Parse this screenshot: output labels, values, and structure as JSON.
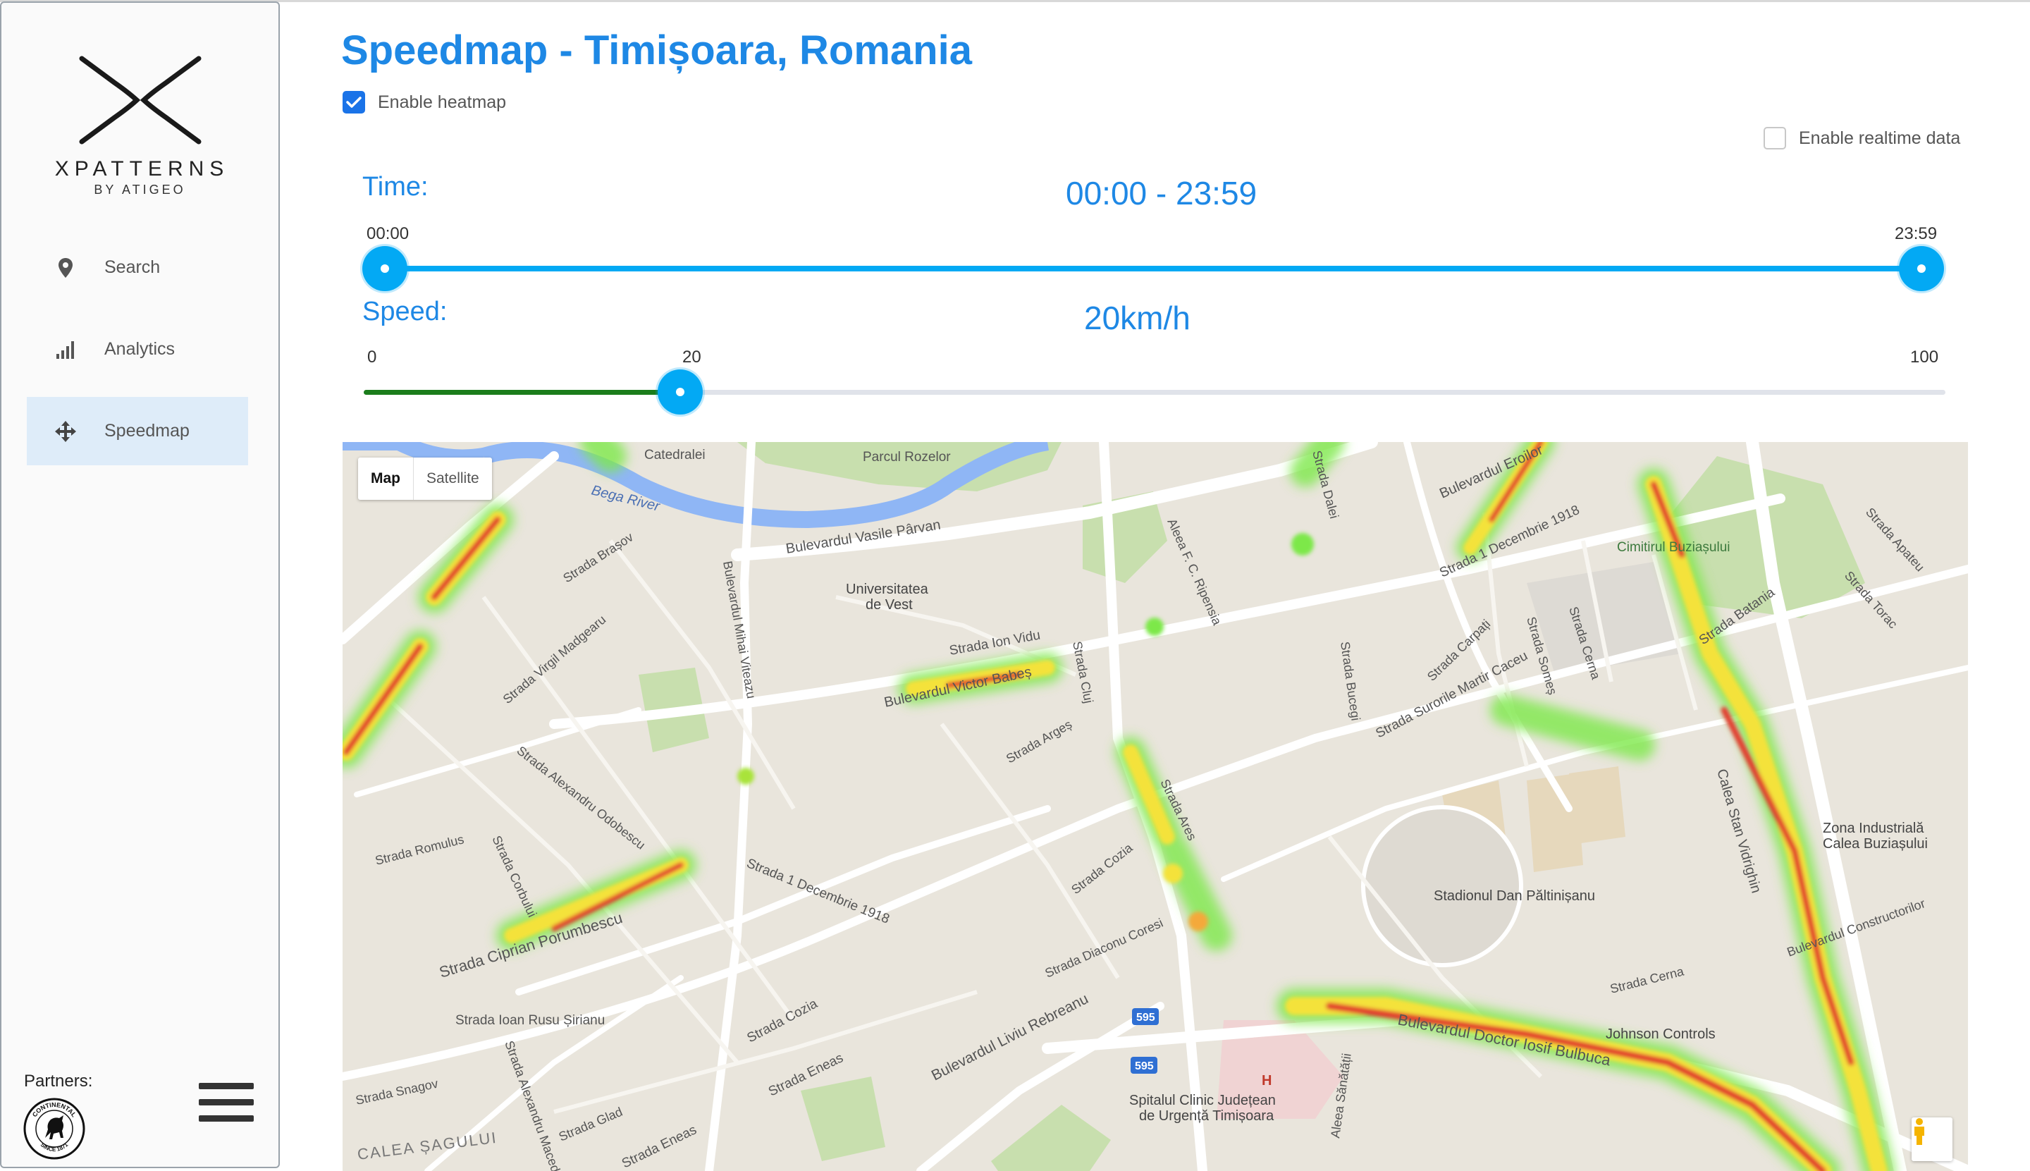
{
  "brand": {
    "name": "XPATTERNS",
    "tagline": "BY ATIGEO"
  },
  "sidebar": {
    "items": [
      {
        "label": "Search",
        "icon": "map-pin-icon",
        "active": false
      },
      {
        "label": "Analytics",
        "icon": "signal-bars-icon",
        "active": false
      },
      {
        "label": "Speedmap",
        "icon": "move-arrows-icon",
        "active": true
      }
    ],
    "partners_label": "Partners:",
    "partner_logo": {
      "name": "continental-logo",
      "text_top": "CONTINENTAL",
      "text_bottom": "SINCE 1871"
    },
    "menu_icon": "hamburger-icon"
  },
  "header": {
    "title": "Speedmap - Timișoara, Romania",
    "enable_heatmap": {
      "label": "Enable heatmap",
      "checked": true
    },
    "enable_realtime": {
      "label": "Enable realtime data",
      "checked": false
    }
  },
  "time_slider": {
    "label": "Time:",
    "value_text": "00:00 - 23:59",
    "min_label": "00:00",
    "max_label": "23:59",
    "range": [
      0,
      1439
    ],
    "low": 0,
    "high": 1439
  },
  "speed_slider": {
    "label": "Speed:",
    "value_text": "20km/h",
    "min_label": "0",
    "mid_label": "20",
    "max_label": "100",
    "range": [
      0,
      100
    ],
    "value": 20
  },
  "map": {
    "type_control": {
      "map": "Map",
      "satellite": "Satellite",
      "selected": "Map"
    },
    "labels": {
      "bega": "Bega River",
      "catedralei": "Catedralei",
      "parcul_rozelor": "Parcul Rozelor",
      "vasile_parvan": "Bulevardul Vasile Pârvan",
      "universitatea": "Universitatea",
      "de_vest": "de Vest",
      "ion_vidu": "Strada Ion Vidu",
      "victor_babes": "Bulevardul Victor Babeș",
      "mihai_viteazu": "Bulevardul Mihai Viteazu",
      "brasov": "Strada Brașov",
      "virgil_madgearu": "Strada Virgil Madgearu",
      "alexandru_odobescu": "Strada Alexandru Odobescu",
      "romulus": "Strada Romulus",
      "corbului": "Strada Corbului",
      "ciprian_porumbescu": "Strada Ciprian Porumbescu",
      "dec1918_a": "Strada 1 Decembrie 1918",
      "dec1918_b": "Strada 1 Decembrie 1918",
      "arges": "Strada Argeș",
      "cluj": "Strada Cluj",
      "ares": "Strada Ares",
      "cozia_a": "Strada Cozia",
      "cozia_b": "Strada Cozia",
      "diaconu_coresi": "Strada Diaconu Coresi",
      "ioan_rusu": "Strada Ioan Rusu Șirianu",
      "alexandru_macedonski": "Strada Alexandru Macedonski",
      "snagov": "Strada Snagov",
      "glad": "Strada Glad",
      "eneas_a": "Strada Eneas",
      "eneas_b": "Strada Eneas",
      "liviu_rebreanu": "Bulevardul Liviu Rebreanu",
      "calea_sagului": "CALEA ȘAGULUI",
      "ripensia": "Aleea F. C. Ripensia",
      "dalei": "Strada Dalei",
      "bucegi": "Strada Bucegi",
      "carpati": "Strada Carpați",
      "surorile_martir": "Strada Surorile Martir Caceu",
      "somes": "Strada Someș",
      "cerna_a": "Strada Cerna",
      "cerna_b": "Strada Cerna",
      "stadion": "Stadionul Dan Păltinișanu",
      "spital1": "Spitalul Clinic Județean",
      "spital2": "de Urgență Timișoara",
      "iosif_bulbuca": "Bulevardul Doctor Iosif Bulbuca",
      "johnson": "Johnson Controls",
      "constructorilor": "Bulevardul Constructorilor",
      "zona1": "Zona Industrială",
      "zona2": "Calea Buziașului",
      "calea_stan_vidrighin": "Calea Stan Vidrighin",
      "cimitirul": "Cimitirul Buziașului",
      "batania": "Strada Batania",
      "torac": "Strada Torac",
      "apateu": "Strada Apateu",
      "sanatatii": "Aleea Sănătății",
      "eroilor": "Bulevardul Eroilor",
      "bv595a": "595",
      "bv595b": "595"
    }
  }
}
